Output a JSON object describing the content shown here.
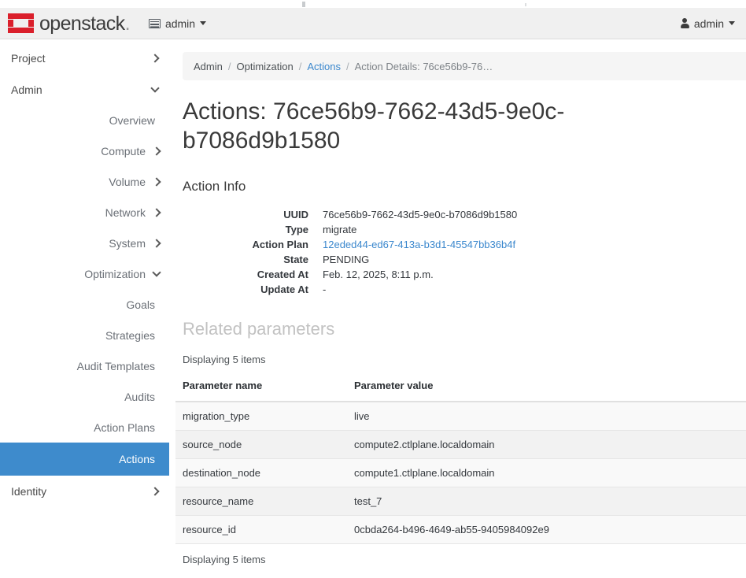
{
  "header": {
    "logo_text": "openstack",
    "logo_dot": ".",
    "project_label": "admin",
    "project_icon": "grid-icon",
    "user_label": "admin",
    "user_icon": "user-icon"
  },
  "sidebar": {
    "top_items": [
      {
        "label": "Project",
        "state": "collapsed",
        "icon": "chevron-right-icon"
      },
      {
        "label": "Admin",
        "state": "expanded",
        "icon": "chevron-down-icon"
      }
    ],
    "items": [
      {
        "label": "Overview",
        "type": "leaf",
        "active": false
      },
      {
        "label": "Compute",
        "type": "group",
        "active": false,
        "icon": "chevron-right-icon"
      },
      {
        "label": "Volume",
        "type": "group",
        "active": false,
        "icon": "chevron-right-icon"
      },
      {
        "label": "Network",
        "type": "group",
        "active": false,
        "icon": "chevron-right-icon"
      },
      {
        "label": "System",
        "type": "group",
        "active": false,
        "icon": "chevron-right-icon"
      },
      {
        "label": "Optimization",
        "type": "group",
        "active": false,
        "icon": "chevron-down-icon"
      },
      {
        "label": "Goals",
        "type": "leaf2",
        "active": false
      },
      {
        "label": "Strategies",
        "type": "leaf2",
        "active": false
      },
      {
        "label": "Audit Templates",
        "type": "leaf2",
        "active": false
      },
      {
        "label": "Audits",
        "type": "leaf2",
        "active": false
      },
      {
        "label": "Action Plans",
        "type": "leaf2",
        "active": false
      },
      {
        "label": "Actions",
        "type": "leaf2",
        "active": true
      },
      {
        "label": "Identity",
        "type": "group",
        "active": false,
        "icon": "chevron-right-icon"
      }
    ]
  },
  "breadcrumb": {
    "items": [
      {
        "label": "Admin",
        "kind": "plain"
      },
      {
        "label": "Optimization",
        "kind": "plain"
      },
      {
        "label": "Actions",
        "kind": "link"
      },
      {
        "label": "Action Details: 76ce56b9-76…",
        "kind": "current"
      }
    ],
    "separator": "/"
  },
  "page": {
    "title": "Actions: 76ce56b9-7662-43d5-9e0c-b7086d9b1580",
    "action_info_heading": "Action Info",
    "related_heading": "Related parameters",
    "displaying_top": "Displaying 5 items",
    "displaying_bottom": "Displaying 5 items"
  },
  "action_info": [
    {
      "label": "UUID",
      "value": "76ce56b9-7662-43d5-9e0c-b7086d9b1580",
      "link": false
    },
    {
      "label": "Type",
      "value": "migrate",
      "link": false
    },
    {
      "label": "Action Plan",
      "value": "12eded44-ed67-413a-b3d1-45547bb36b4f",
      "link": true
    },
    {
      "label": "State",
      "value": "PENDING",
      "link": false
    },
    {
      "label": "Created At",
      "value": "Feb. 12, 2025, 8:11 p.m.",
      "link": false
    },
    {
      "label": "Update At",
      "value": "-",
      "link": false
    }
  ],
  "params_table": {
    "columns": [
      "Parameter name",
      "Parameter value"
    ],
    "rows": [
      {
        "name": "migration_type",
        "value": "live"
      },
      {
        "name": "source_node",
        "value": "compute2.ctlplane.localdomain"
      },
      {
        "name": "destination_node",
        "value": "compute1.ctlplane.localdomain"
      },
      {
        "name": "resource_name",
        "value": "test_7"
      },
      {
        "name": "resource_id",
        "value": "0cbda264-b496-4649-ab55-9405984092e9"
      }
    ]
  },
  "colors": {
    "accent_blue": "#3e8bcc",
    "link_blue": "#3a87cd",
    "brand_red": "#da1f2b",
    "navbar_bg": "#f0f0f0",
    "panel_bg": "#f5f5f5"
  }
}
